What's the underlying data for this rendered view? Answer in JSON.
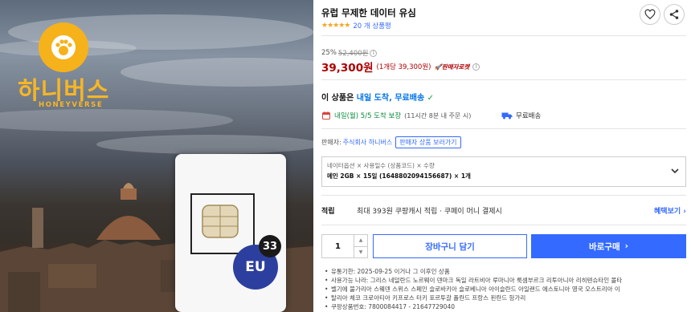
{
  "hero": {
    "brand_ko": "하니버스",
    "brand_en": "HONEYVERSE",
    "eu_label": "EU",
    "count_badge": "33"
  },
  "product": {
    "title": "유럽 무제한 데이터 유심",
    "rating": 4.5,
    "review_count": "20 개 상품평",
    "discount_rate": "25%",
    "original_price": "52,400원",
    "price": "39,300원",
    "unit_price": "(1개당 39,300원)",
    "rocket_label": "판매자로켓"
  },
  "delivery": {
    "headline_prefix": "이 상품은",
    "headline_highlight": "내일 도착, 무료배송",
    "arrival_text": "내일(월) 5/5 도착 보장",
    "arrival_sub": "(11시간 8분 내 주문 시)",
    "free_shipping": "무료배송"
  },
  "seller": {
    "label": "판매자:",
    "name": "주식회사 하니버스",
    "more_button": "판매자 상품 보러가기"
  },
  "option": {
    "header": "네이터옵션 × 사용일수 (상품코드) × 수량",
    "selected": "메인 2GB × 15일 (1648802094156687) × 1개"
  },
  "reward": {
    "label": "적립",
    "text": "최대 393원 쿠팡캐시 적립 · 쿠페이 머니 결제시",
    "more": "혜택보기"
  },
  "purchase": {
    "quantity": "1",
    "cart_button": "장바구니 담기",
    "buy_button": "바로구매"
  },
  "details": [
    "유통기한: 2025-09-25 이거나 그 이후인 상품",
    "사용가능 나라: 그리스 네덜란드 노르웨이 덴마크 독일 라트비아 루마니아 룩셈부르크 리투아니아 리히텐슈타인 몰타",
    "벨기에 불가리아 스웨덴 스위스 스페인 슬로바키아 슬로베니아 아이슬란드 아일랜드 에스토니아 영국 오스트리아 이",
    "탈리아 체코 크로아티아 키프로스 터키 포르투갈 폴란드 프랑스 핀란드 헝가리",
    "쿠팡상품번호: 7800084417 - 21647729040"
  ],
  "colors": {
    "accent_blue": "#346aff",
    "price_red": "#ae0000",
    "star": "#f5a623",
    "brand_yellow": "#f7b624"
  },
  "icons": [
    "heart-icon",
    "share-icon",
    "calendar-icon",
    "truck-icon",
    "info-icon",
    "chevron-right-icon",
    "chevron-down-icon"
  ]
}
